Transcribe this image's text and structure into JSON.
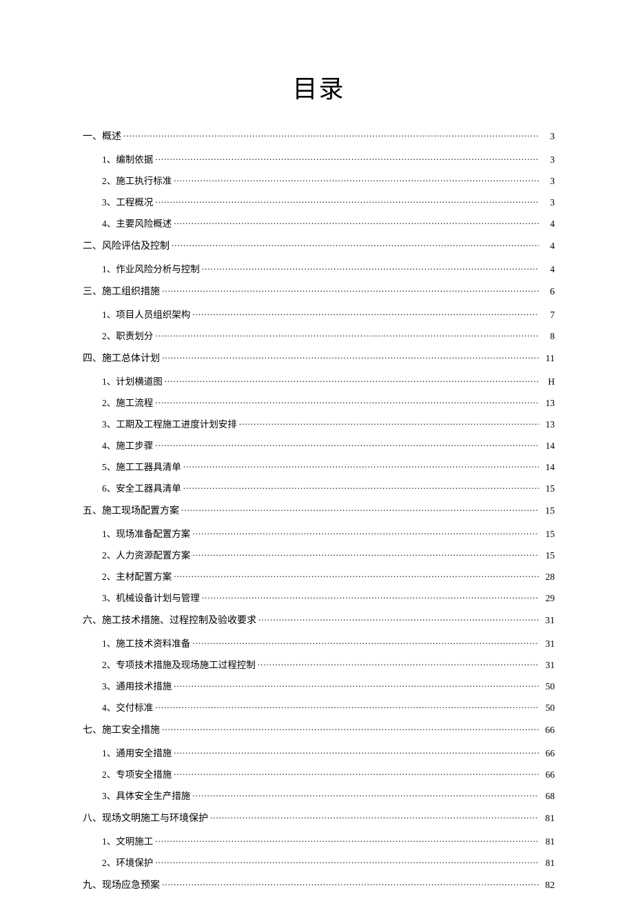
{
  "title": "目录",
  "toc": [
    {
      "level": 1,
      "label": "一、概述",
      "page": "3"
    },
    {
      "level": 2,
      "label": "1、编制依据",
      "page": "3"
    },
    {
      "level": 2,
      "label": "2、施工执行标准",
      "page": "3"
    },
    {
      "level": 2,
      "label": "3、工程概况",
      "page": "3"
    },
    {
      "level": 2,
      "label": "4、主要风险概述",
      "page": "4"
    },
    {
      "level": 1,
      "label": "二、风险评估及控制",
      "page": "4"
    },
    {
      "level": 2,
      "label": "1、作业风险分析与控制",
      "page": "4"
    },
    {
      "level": 1,
      "label": "三、施工组织措施",
      "page": "6"
    },
    {
      "level": 2,
      "label": "1、项目人员组织架构",
      "page": "7"
    },
    {
      "level": 2,
      "label": "2、职责划分",
      "page": "8"
    },
    {
      "level": 1,
      "label": "四、施工总体计划",
      "page": "11"
    },
    {
      "level": 2,
      "label": "1、计划横道图",
      "page": "H"
    },
    {
      "level": 2,
      "label": "2、施工流程",
      "page": "13"
    },
    {
      "level": 2,
      "label": "3、工期及工程施工进度计划安排",
      "page": "13"
    },
    {
      "level": 2,
      "label": "4、施工步骤",
      "page": "14"
    },
    {
      "level": 2,
      "label": "5、施工工器具清单",
      "page": "14"
    },
    {
      "level": 2,
      "label": "6、安全工器具清单",
      "page": "15"
    },
    {
      "level": 1,
      "label": "五、施工现场配置方案",
      "page": "15"
    },
    {
      "level": 2,
      "label": "1、现场准备配置方案",
      "page": "15"
    },
    {
      "level": 2,
      "label": "2、人力资源配置方案",
      "page": "15"
    },
    {
      "level": 2,
      "label": "2、主材配置方案",
      "page": "28"
    },
    {
      "level": 2,
      "label": "3、机械设备计划与管理",
      "page": "29"
    },
    {
      "level": 1,
      "label": "六、施工技术措施、过程控制及验收要求",
      "page": "31"
    },
    {
      "level": 2,
      "label": "1、施工技术资料准备",
      "page": "31"
    },
    {
      "level": 2,
      "label": "2、专项技术措施及现场施工过程控制",
      "page": "31"
    },
    {
      "level": 2,
      "label": "3、通用技术措施",
      "page": "50"
    },
    {
      "level": 2,
      "label": "4、交付标准",
      "page": "50"
    },
    {
      "level": 1,
      "label": "七、施工安全措施",
      "page": "66"
    },
    {
      "level": 2,
      "label": "1、通用安全措施",
      "page": "66"
    },
    {
      "level": 2,
      "label": "2、专项安全措施",
      "page": "66"
    },
    {
      "level": 2,
      "label": "3、具体安全生产措施",
      "page": "68"
    },
    {
      "level": 1,
      "label": "八、现场文明施工与环境保护",
      "page": "81"
    },
    {
      "level": 2,
      "label": "1、文明施工",
      "page": "81"
    },
    {
      "level": 2,
      "label": "2、环境保护",
      "page": "81"
    },
    {
      "level": 1,
      "label": "九、现场应急预案",
      "page": "82"
    }
  ]
}
